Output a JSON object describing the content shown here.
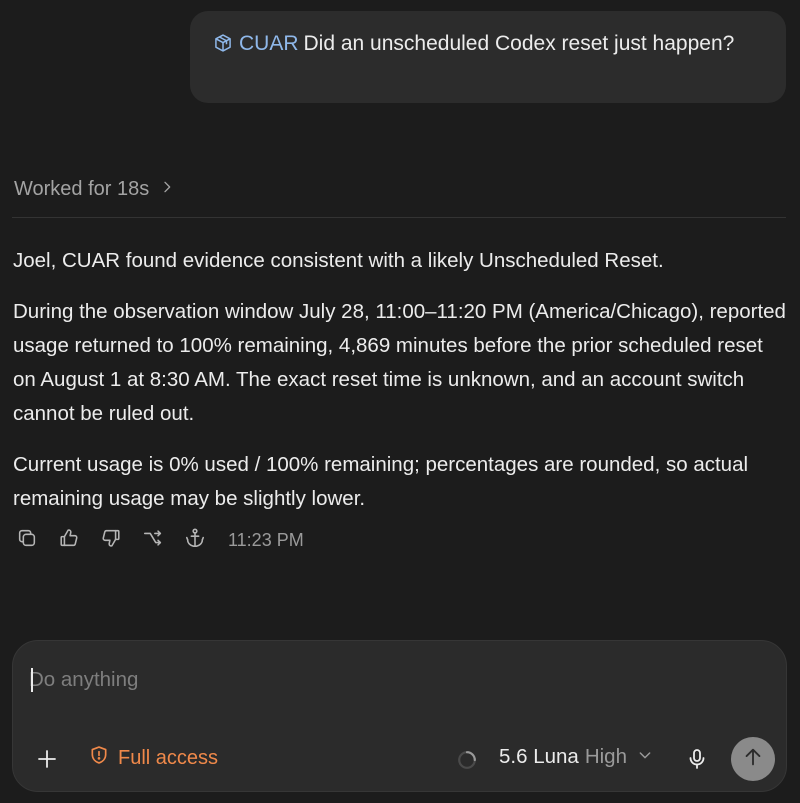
{
  "user_message": {
    "tag_icon": "cube-icon",
    "tag_label": "CUAR",
    "text": "Did an unscheduled Codex reset just happen?"
  },
  "worked": {
    "label": "Worked for 18s",
    "icon": "chevron-right-icon"
  },
  "answer": {
    "paragraphs": [
      "Joel, CUAR found evidence consistent with a likely Unscheduled Reset.",
      "During the observation window July 28, 11:00–11:20 PM (America/Chicago), reported usage returned to 100% remaining, 4,869 minutes before the prior scheduled reset on August 1 at 8:30 AM. The exact reset time is unknown, and an account switch cannot be ruled out.",
      "Current usage is 0% used / 100% remaining; percentages are rounded, so actual remaining usage may be slightly lower."
    ]
  },
  "actions": {
    "icons": [
      "copy-icon",
      "thumbs-up-icon",
      "thumbs-down-icon",
      "branch-icon",
      "anchor-icon"
    ],
    "timestamp": "11:23 PM"
  },
  "composer": {
    "placeholder": "Do anything",
    "value": "",
    "access_label": "Full access",
    "model_name": "5.6 Luna",
    "model_effort": "High"
  },
  "colors": {
    "background": "#1c1c1c",
    "bubble": "#2c2c2c",
    "composer": "#2b2b2b",
    "tag": "#8fb8ea",
    "access": "#f0894a",
    "send": "#8a8a8a"
  }
}
